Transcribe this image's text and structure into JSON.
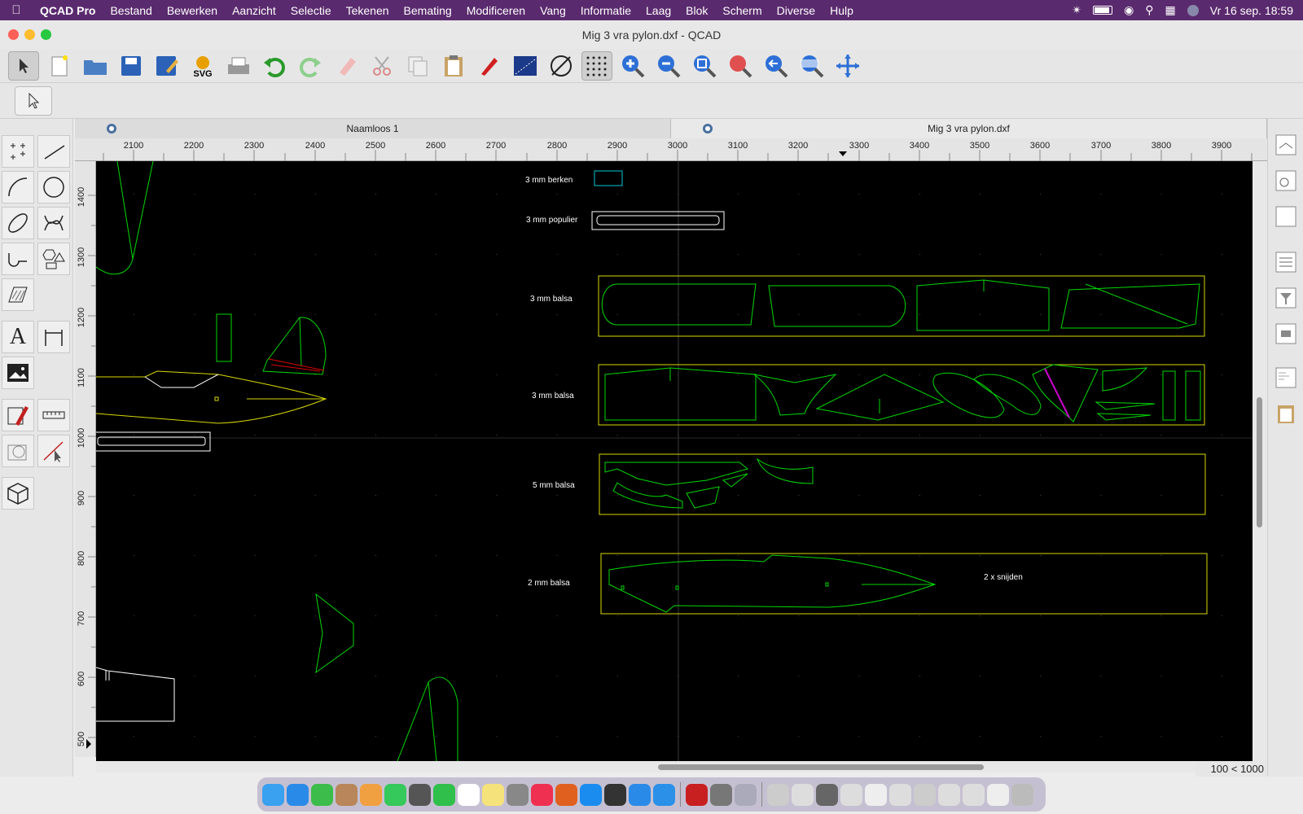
{
  "menubar": {
    "app": "QCAD Pro",
    "items": [
      "Bestand",
      "Bewerken",
      "Aanzicht",
      "Selectie",
      "Tekenen",
      "Bemating",
      "Modificeren",
      "Vang",
      "Informatie",
      "Laag",
      "Blok",
      "Scherm",
      "Diverse",
      "Hulp"
    ],
    "clock": "Vr 16 sep.  18:59"
  },
  "window": {
    "title": "Mig 3 vra pylon.dxf - QCAD"
  },
  "toolbar": {
    "icons": [
      "pointer-icon",
      "new-file-icon",
      "open-folder-icon",
      "save-icon",
      "save-as-icon",
      "svg-export-icon",
      "print-preview-icon",
      "undo-icon",
      "redo-icon",
      "eraser-icon",
      "cut-icon",
      "copy-icon",
      "paste-icon",
      "pen-icon",
      "area-icon",
      "no-snap-icon",
      "grid-icon",
      "zoom-in-icon",
      "zoom-out-icon",
      "zoom-auto-icon",
      "zoom-selection-icon",
      "zoom-previous-icon",
      "zoom-window-icon",
      "pan-icon"
    ]
  },
  "tabs": [
    {
      "label": "Naamloos 1",
      "active": false
    },
    {
      "label": "Mig 3 vra pylon.dxf",
      "active": true
    }
  ],
  "ruler": {
    "x_ticks": [
      "2100",
      "2200",
      "2300",
      "2400",
      "2500",
      "2600",
      "2700",
      "2800",
      "2900",
      "3000",
      "3100",
      "3200",
      "3300",
      "3400",
      "3500",
      "3600",
      "3700",
      "3800",
      "3900"
    ],
    "y_ticks": [
      "1400",
      "1300",
      "1200",
      "1100",
      "1000",
      "900",
      "800",
      "700",
      "600",
      "500"
    ]
  },
  "drawing": {
    "labels": [
      "3 mm berken",
      "3 mm populier",
      "3 mm balsa",
      "3 mm balsa",
      "5 mm balsa",
      "2 mm balsa"
    ],
    "note": "2 x snijden",
    "colors": {
      "background": "#000000",
      "parts": "#00d800",
      "sheet": "#d8d800",
      "outline": "#ffffff",
      "highlight": "#e00000",
      "magenta": "#d000d0",
      "cyan": "#00c8d8"
    }
  },
  "status": {
    "grid": "100 < 1000"
  }
}
